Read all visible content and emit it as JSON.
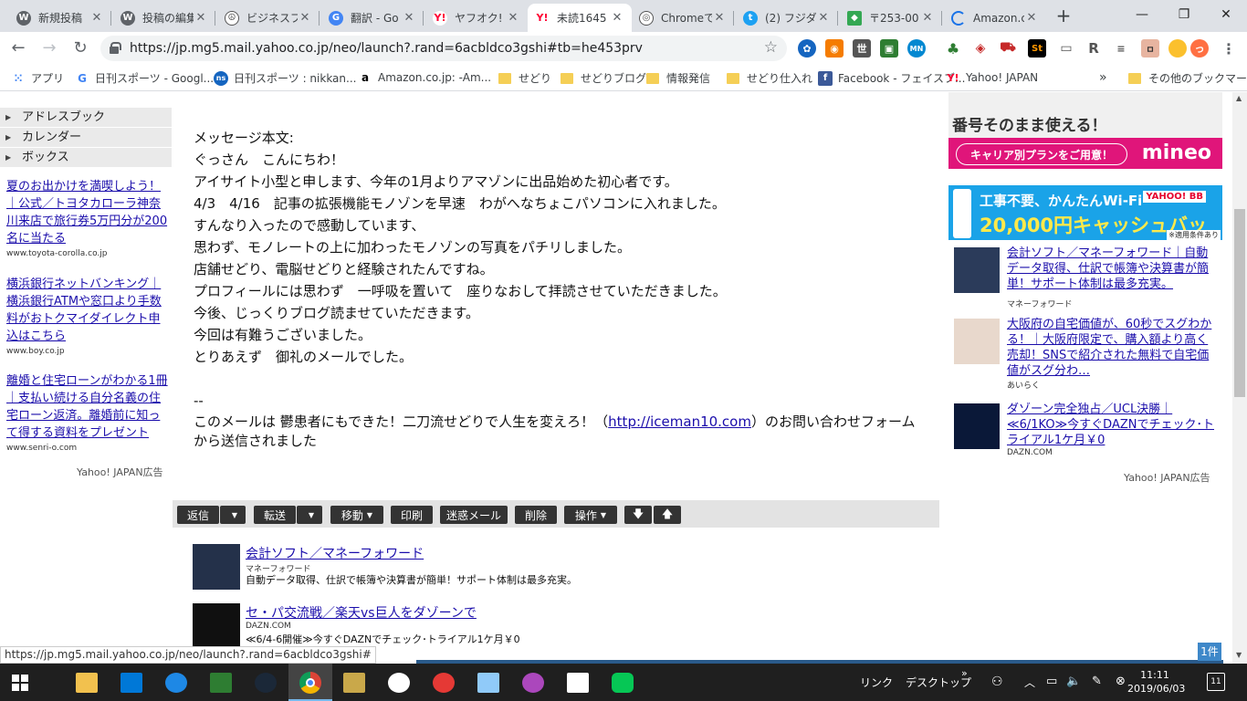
{
  "browser": {
    "tabs": [
      {
        "title": "新規投稿"
      },
      {
        "title": "投稿の編集"
      },
      {
        "title": "ビジネスプ"
      },
      {
        "title": "翻訳 - Go"
      },
      {
        "title": "ヤフオク!"
      },
      {
        "title": "未読1645"
      },
      {
        "title": "Chromeで"
      },
      {
        "title": "(2) フジダ"
      },
      {
        "title": "〒253-00"
      },
      {
        "title": "Amazon.c"
      }
    ],
    "url": "https://jp.mg5.mail.yahoo.co.jp/neo/launch?.rand=6acbldco3gshi#tb=he453prv",
    "bookmarks": [
      {
        "label": "アプリ"
      },
      {
        "label": "日刊スポーツ - Googl..."
      },
      {
        "label": "日刊スポーツ : nikkan..."
      },
      {
        "label": "Amazon.co.jp: -Am..."
      },
      {
        "label": "せどり"
      },
      {
        "label": "せどりブログ"
      },
      {
        "label": "情報発信"
      },
      {
        "label": "せどり仕入れ"
      },
      {
        "label": "Facebook - フェイスブ..."
      },
      {
        "label": "Yahoo! JAPAN"
      },
      {
        "label": "その他のブックマーク"
      }
    ],
    "bookmarks_more": "»",
    "status_url": "https://jp.mg5.mail.yahoo.co.jp/neo/launch?.rand=6acbldco3gshi#"
  },
  "sidebar": {
    "nav": [
      {
        "label": "アドレスブック"
      },
      {
        "label": "カレンダー"
      },
      {
        "label": "ボックス"
      }
    ],
    "ads": [
      {
        "title": "夏のお出かけを満喫しよう！｜公式／トヨタカローラ神奈川来店で旅行券5万円分が200名に当たる",
        "domain": "www.toyota-corolla.co.jp"
      },
      {
        "title": "横浜銀行ネットバンキング｜横浜銀行ATMや窓口より手数料がおトクマイダイレクト申込はこちら",
        "domain": "www.boy.co.jp"
      },
      {
        "title": "離婚と住宅ローンがわかる1冊｜支払い続ける自分名義の住宅ローン返済。離婚前に知って得する資料をプレゼント",
        "domain": "www.senri-o.com"
      }
    ],
    "ad_label": "Yahoo! JAPAN広告"
  },
  "message": {
    "lines": [
      "メッセージ本文:",
      "ぐっさん　こんにちわ！",
      "アイサイト小型と申します、今年の1月よりアマゾンに出品始めた初心者です。",
      "4/3　4/16　記事の拡張機能モノゾンを早速　わがへなちょこパソコンに入れました。",
      "すんなり入ったので感動しています、",
      "思わず、モノレートの上に加わったモノゾンの写真をパチリしました。",
      "店舗せどり、電脳せどりと経験されたんですね。",
      "プロフィールには思わず　一呼吸を置いて　座りなおして拝読させていただきました。",
      "今後、じっくりブログ読ませていただきます。",
      "今回は有難うございました。",
      "とりあえず　御礼のメールでした。"
    ],
    "signature_sep": "--",
    "footer_before": "このメールは 鬱患者にもできた！二刀流せどりで人生を変えろ！（",
    "footer_link": "http://iceman10.com",
    "footer_after": "）のお問い合わせフォームから送信されました"
  },
  "actions": {
    "reply": "返信",
    "forward": "転送",
    "move": "移動",
    "print": "印刷",
    "spam": "迷惑メール",
    "delete": "削除",
    "operate": "操作"
  },
  "promos": [
    {
      "title": "会計ソフト／マネーフォワード",
      "sponsor": "マネーフォワード",
      "desc": "自動データ取得、仕訳で帳簿や決算書が簡単！サポート体制は最多充実。"
    },
    {
      "title": "セ・パ交流戦／楽天vs巨人をダゾーンで",
      "sponsor": "DAZN.COM",
      "desc": "≪6/4-6開催≫今すぐDAZNでチェック･トライアル1ケ月￥0"
    }
  ],
  "right_ads": {
    "mineo_line": "番号そのまま使える！",
    "mineo_cta": "キャリア別プランをご用意！",
    "mineo_brand": "mineo",
    "wifi_line1": "工事不要、かんたんWi-Fi",
    "wifi_line2": "20,000円キャッシュバック",
    "wifi_logo": "YAHOO! BB",
    "wifi_note": "※適用条件あり",
    "items": [
      {
        "title": "会計ソフト／マネーフォワード｜自動データ取得、仕訳で帳簿や決算書が簡単！サポート体制は最多充実。",
        "sponsor": "マネーフォワード"
      },
      {
        "title": "大阪府の自宅価値が、60秒でスグわかる！｜大阪府限定で、購入額より高く売却！SNSで紹介された無料で自宅価値がスグ分わ…",
        "sponsor": "あいらく"
      },
      {
        "title": "ダゾーン完全独占／UCL決勝｜≪6/1KO≫今すぐDAZNでチェック･トライアル1ケ月￥0",
        "sponsor": "DAZN.COM"
      }
    ],
    "ad_label": "Yahoo! JAPAN広告"
  },
  "count_badge": "1件",
  "taskbar": {
    "link_label": "リンク",
    "desktop_label": "デスクトップ",
    "time": "11:11",
    "date": "2019/06/03",
    "notif": "11"
  }
}
